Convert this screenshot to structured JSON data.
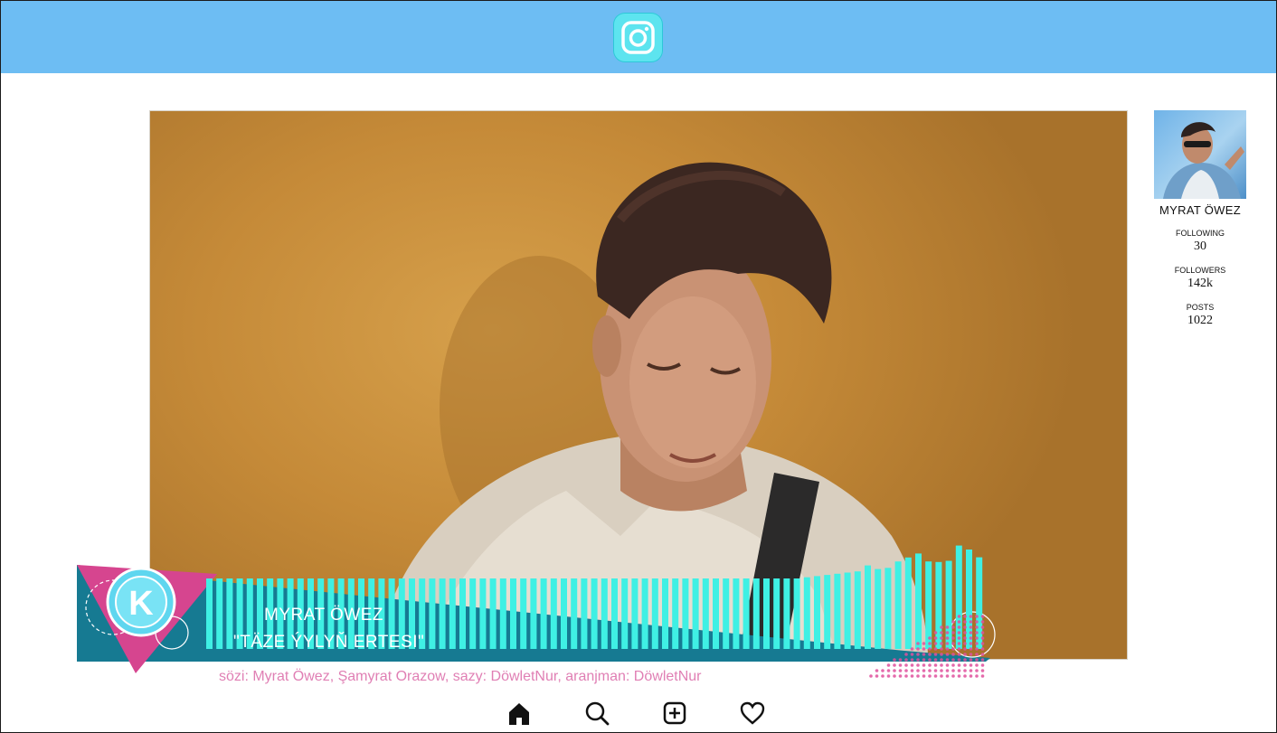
{
  "app": {
    "logo_icon": "instagram-icon",
    "accent": "#6dbdf3"
  },
  "profile": {
    "name": "MYRAT ÖWEZ",
    "stats": [
      {
        "label": "FOLLOWING",
        "value": "30"
      },
      {
        "label": "FOLLOWERS",
        "value": "142k"
      },
      {
        "label": "POSTS",
        "value": "1022"
      }
    ]
  },
  "video_overlay": {
    "channel_logo": "K",
    "artist": "MYRAT ÖWEZ",
    "title": "\"TÄZE ÝYLYŇ ERTESI\"",
    "credits": "sözi: Myrat Öwez, Şamyrat Orazow, sazy: DöwletNur,  aranjman: DöwletNur",
    "bar_color": "#3ff0e4",
    "banner_color": "#167a92"
  },
  "nav": [
    {
      "name": "home",
      "icon": "home-icon"
    },
    {
      "name": "search",
      "icon": "search-icon"
    },
    {
      "name": "add",
      "icon": "add-post-icon"
    },
    {
      "name": "likes",
      "icon": "heart-icon"
    }
  ]
}
